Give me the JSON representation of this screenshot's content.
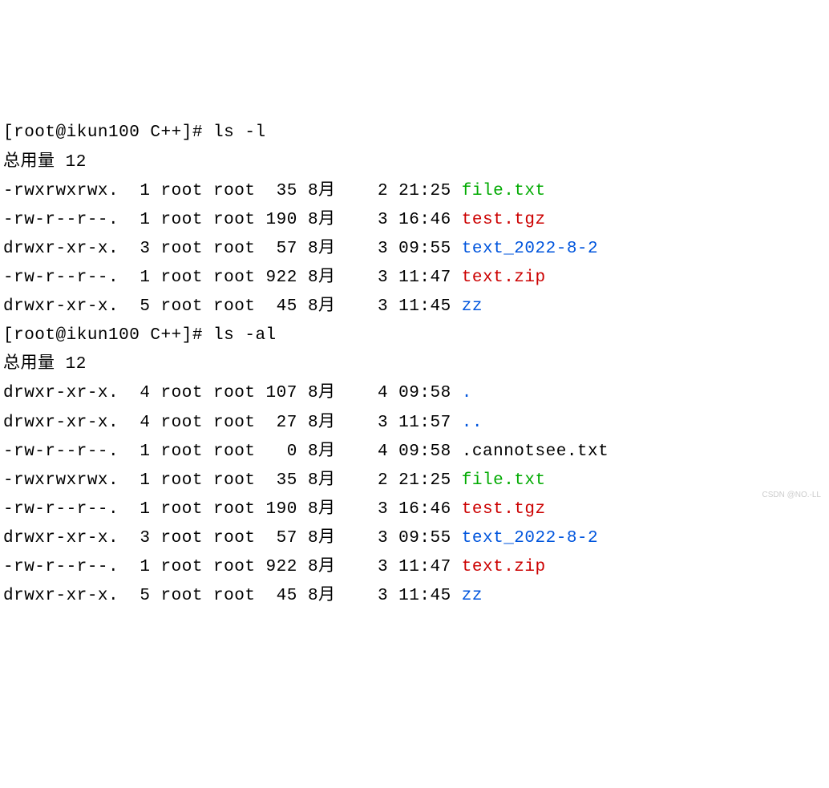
{
  "prompt1": "[root@ikun100 C++]# ls -l",
  "total1": "总用量 12",
  "listing1": [
    {
      "perms": "-rwxrwxrwx.",
      "links": "1",
      "owner": "root",
      "group": "root",
      "size": "35",
      "month": "8月",
      "day": "2",
      "time": "21:25",
      "name": "file.txt",
      "color": "green"
    },
    {
      "perms": "-rw-r--r--.",
      "links": "1",
      "owner": "root",
      "group": "root",
      "size": "190",
      "month": "8月",
      "day": "3",
      "time": "16:46",
      "name": "test.tgz",
      "color": "red"
    },
    {
      "perms": "drwxr-xr-x.",
      "links": "3",
      "owner": "root",
      "group": "root",
      "size": "57",
      "month": "8月",
      "day": "3",
      "time": "09:55",
      "name": "text_2022-8-2",
      "color": "blue"
    },
    {
      "perms": "-rw-r--r--.",
      "links": "1",
      "owner": "root",
      "group": "root",
      "size": "922",
      "month": "8月",
      "day": "3",
      "time": "11:47",
      "name": "text.zip",
      "color": "red"
    },
    {
      "perms": "drwxr-xr-x.",
      "links": "5",
      "owner": "root",
      "group": "root",
      "size": "45",
      "month": "8月",
      "day": "3",
      "time": "11:45",
      "name": "zz",
      "color": "blue"
    }
  ],
  "prompt2": "[root@ikun100 C++]# ls -al",
  "total2": "总用量 12",
  "listing2": [
    {
      "perms": "drwxr-xr-x.",
      "links": "4",
      "owner": "root",
      "group": "root",
      "size": "107",
      "month": "8月",
      "day": "4",
      "time": "09:58",
      "name": ".",
      "color": "blue"
    },
    {
      "perms": "drwxr-xr-x.",
      "links": "4",
      "owner": "root",
      "group": "root",
      "size": "27",
      "month": "8月",
      "day": "3",
      "time": "11:57",
      "name": "..",
      "color": "blue"
    },
    {
      "perms": "-rw-r--r--.",
      "links": "1",
      "owner": "root",
      "group": "root",
      "size": "0",
      "month": "8月",
      "day": "4",
      "time": "09:58",
      "name": ".cannotsee.txt",
      "color": "black"
    },
    {
      "perms": "-rwxrwxrwx.",
      "links": "1",
      "owner": "root",
      "group": "root",
      "size": "35",
      "month": "8月",
      "day": "2",
      "time": "21:25",
      "name": "file.txt",
      "color": "green"
    },
    {
      "perms": "-rw-r--r--.",
      "links": "1",
      "owner": "root",
      "group": "root",
      "size": "190",
      "month": "8月",
      "day": "3",
      "time": "16:46",
      "name": "test.tgz",
      "color": "red"
    },
    {
      "perms": "drwxr-xr-x.",
      "links": "3",
      "owner": "root",
      "group": "root",
      "size": "57",
      "month": "8月",
      "day": "3",
      "time": "09:55",
      "name": "text_2022-8-2",
      "color": "blue"
    },
    {
      "perms": "-rw-r--r--.",
      "links": "1",
      "owner": "root",
      "group": "root",
      "size": "922",
      "month": "8月",
      "day": "3",
      "time": "11:47",
      "name": "text.zip",
      "color": "red"
    },
    {
      "perms": "drwxr-xr-x.",
      "links": "5",
      "owner": "root",
      "group": "root",
      "size": "45",
      "month": "8月",
      "day": "3",
      "time": "11:45",
      "name": "zz",
      "color": "blue"
    }
  ],
  "watermark": "CSDN @NO.-LL"
}
